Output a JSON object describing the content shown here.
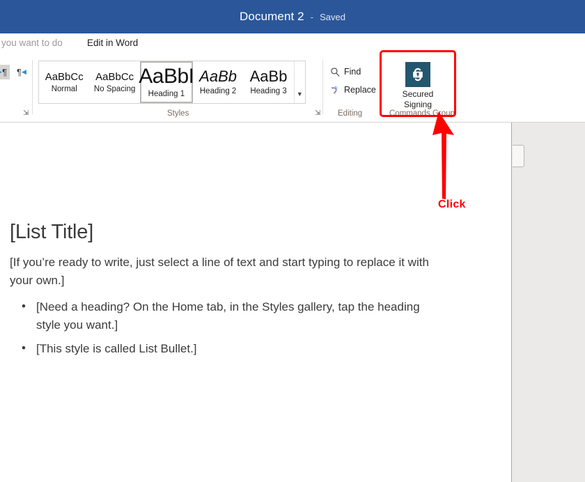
{
  "titlebar": {
    "document_title": "Document 2",
    "separator": "-",
    "save_state": "Saved"
  },
  "tellme": {
    "search_text": "you want to do",
    "edit_in_word": "Edit in Word"
  },
  "ribbon": {
    "paragraph_direction": {
      "ltr_icon": "paragraph-ltr-icon",
      "rtl_icon": "paragraph-rtl-icon"
    },
    "styles_group": {
      "caption": "Styles",
      "launcher_icon": "dialog-launcher-icon",
      "more_icon": "chevron-down-icon",
      "items": [
        {
          "preview": "AaBbCc",
          "label": "Normal",
          "selected": false
        },
        {
          "preview": "AaBbCc",
          "label": "No Spacing",
          "selected": false
        },
        {
          "preview": "AaBbI",
          "label": "Heading 1",
          "selected": true
        },
        {
          "preview": "AaBb",
          "label": "Heading 2",
          "selected": false
        },
        {
          "preview": "AaBb",
          "label": "Heading 3",
          "selected": false
        }
      ]
    },
    "editing_group": {
      "caption": "Editing",
      "find_label": "Find",
      "find_icon": "search-icon",
      "replace_label": "Replace",
      "replace_icon": "replace-icon"
    },
    "commands_group": {
      "caption": "Commands Group",
      "secured_signing_label_line1": "Secured",
      "secured_signing_label_line2": "Signing",
      "secured_signing_icon": "secured-signing-padlock-icon",
      "icon_color": "#23566f",
      "highlight_color": "#ff0000"
    }
  },
  "document": {
    "title": "[List Title]",
    "paragraph": "[If you’re ready to write, just select a line of text and start typing to replace it with your own.]",
    "bullets": [
      "[Need a heading? On the Home tab, in the Styles gallery, tap the heading style you want.]",
      "[This style is called List Bullet.]"
    ]
  },
  "annotation": {
    "click_label": "Click",
    "arrow_icon": "up-arrow-annotation-icon",
    "color": "#ff0000"
  }
}
